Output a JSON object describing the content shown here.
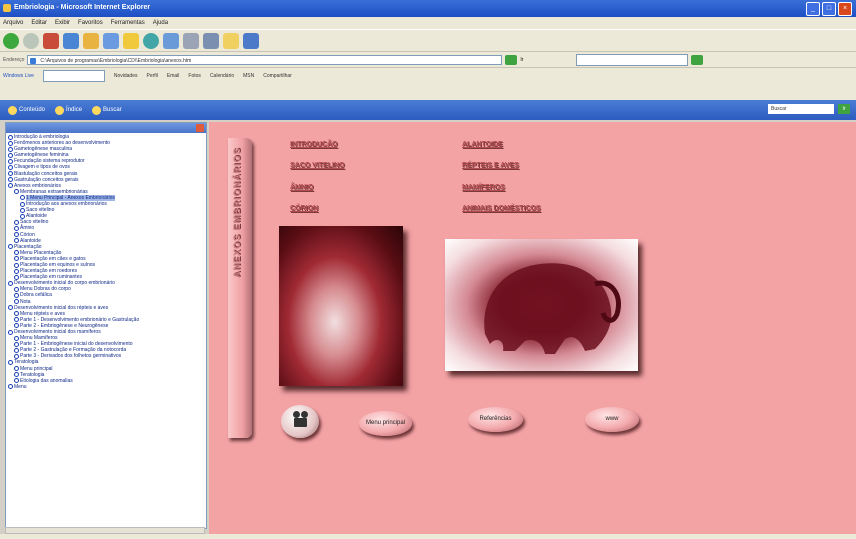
{
  "window": {
    "title": "Embriologia - Microsoft Internet Explorer",
    "controls": [
      "_",
      "□",
      "×"
    ]
  },
  "menu": [
    "Arquivo",
    "Editar",
    "Exibir",
    "Favoritos",
    "Ferramentas",
    "Ajuda"
  ],
  "address": {
    "label": "Endereço",
    "url": "C:\\Arquivos de programas\\Embriologia\\CD\\\\Embriologia\\anexos.htm",
    "go_label": "Ir"
  },
  "links_bar": {
    "items": [
      "Windows Live",
      "Novidades",
      "Perfil",
      "Email",
      "Fotos",
      "Calendário",
      "MSN",
      "Compartilhar"
    ]
  },
  "nav": {
    "items": [
      "Conteúdo",
      "Índice",
      "Buscar"
    ],
    "search_placeholder": "Buscar",
    "search_button": "Ir"
  },
  "sidebar": {
    "tree": [
      {
        "label": "Introdução à embriologia",
        "indent": 0
      },
      {
        "label": "Fenômenos anteriores ao desenvolvimento",
        "indent": 0
      },
      {
        "label": "Gametogênese masculina",
        "indent": 0
      },
      {
        "label": "Gametogênese feminina",
        "indent": 0
      },
      {
        "label": "Fecundação sistema reprodutor",
        "indent": 0
      },
      {
        "label": "Clivagem e tipos de ovos",
        "indent": 0
      },
      {
        "label": "Blastulação conceitos gerais",
        "indent": 0
      },
      {
        "label": "Gastrulação conceitos gerais",
        "indent": 0
      },
      {
        "label": "Anexos embrionários",
        "indent": 0
      },
      {
        "label": "Membranas extraembrionárias",
        "indent": 1
      },
      {
        "label": "1 Menu Principal - Anexos Embrionários",
        "indent": 2,
        "selected": true
      },
      {
        "label": "Introdução aos anexos embrionários",
        "indent": 2
      },
      {
        "label": "Saco vitelino",
        "indent": 2
      },
      {
        "label": "Alantoide",
        "indent": 2
      },
      {
        "label": "Saco vitelino",
        "indent": 1
      },
      {
        "label": "Âmnio",
        "indent": 1
      },
      {
        "label": "Córion",
        "indent": 1
      },
      {
        "label": "Alantoide",
        "indent": 1
      },
      {
        "label": "Placentação",
        "indent": 0
      },
      {
        "label": "Menu Placentação",
        "indent": 1
      },
      {
        "label": "Placentação em cães e gatos",
        "indent": 1
      },
      {
        "label": "Placentação em equinos e suínos",
        "indent": 1
      },
      {
        "label": "Placentação em roedores",
        "indent": 1
      },
      {
        "label": "Placentação em ruminantes",
        "indent": 1
      },
      {
        "label": "Desenvolvimento inicial do corpo embrionário",
        "indent": 0
      },
      {
        "label": "Menu Dobras do corpo",
        "indent": 1
      },
      {
        "label": "Dobra cefálica",
        "indent": 1
      },
      {
        "label": "Nota",
        "indent": 1
      },
      {
        "label": "Desenvolvimento inicial dos répteis e aves",
        "indent": 0
      },
      {
        "label": "Menu répteis e aves",
        "indent": 1
      },
      {
        "label": "Parte 1 - Desenvolvimento embrionário e Gastrulação",
        "indent": 1
      },
      {
        "label": "Parte 2 - Embriogênese e Neurogênese",
        "indent": 1
      },
      {
        "label": "Desenvolvimento inicial dos mamíferos",
        "indent": 0
      },
      {
        "label": "Menu Mamíferos",
        "indent": 1
      },
      {
        "label": "Parte 1 - Embriogênese inicial do desenvolvimento",
        "indent": 1
      },
      {
        "label": "Parte 2 - Gastrulação e Formação da notocorda",
        "indent": 1
      },
      {
        "label": "Parte 3 - Derivados dos folhetos germinativos",
        "indent": 1
      },
      {
        "label": "Teratologia",
        "indent": 0
      },
      {
        "label": "Menu principal",
        "indent": 1
      },
      {
        "label": "Teratologia",
        "indent": 1
      },
      {
        "label": "Etiologia das anomalias",
        "indent": 1
      },
      {
        "label": "Menu",
        "indent": 0
      }
    ]
  },
  "content": {
    "vertical_title": "ANEXOS EMBRIONÁRIOS",
    "links_left": [
      "INTRODUÇÃO",
      "SACO VITELINO",
      "ÂMNIO",
      "CÓRION"
    ],
    "links_right": [
      "ALANTOIDE",
      "RÉPTEIS E AVES",
      "MAMÍFEROS",
      "ANIMAIS DOMÉSTICOS"
    ],
    "buttons": {
      "menu": "Menu principal",
      "references": "Referências",
      "www": "www"
    }
  },
  "colors": {
    "content_bg": "#f4a3a5",
    "link": "#b34d50",
    "titlebar": "#1d4fc4"
  }
}
